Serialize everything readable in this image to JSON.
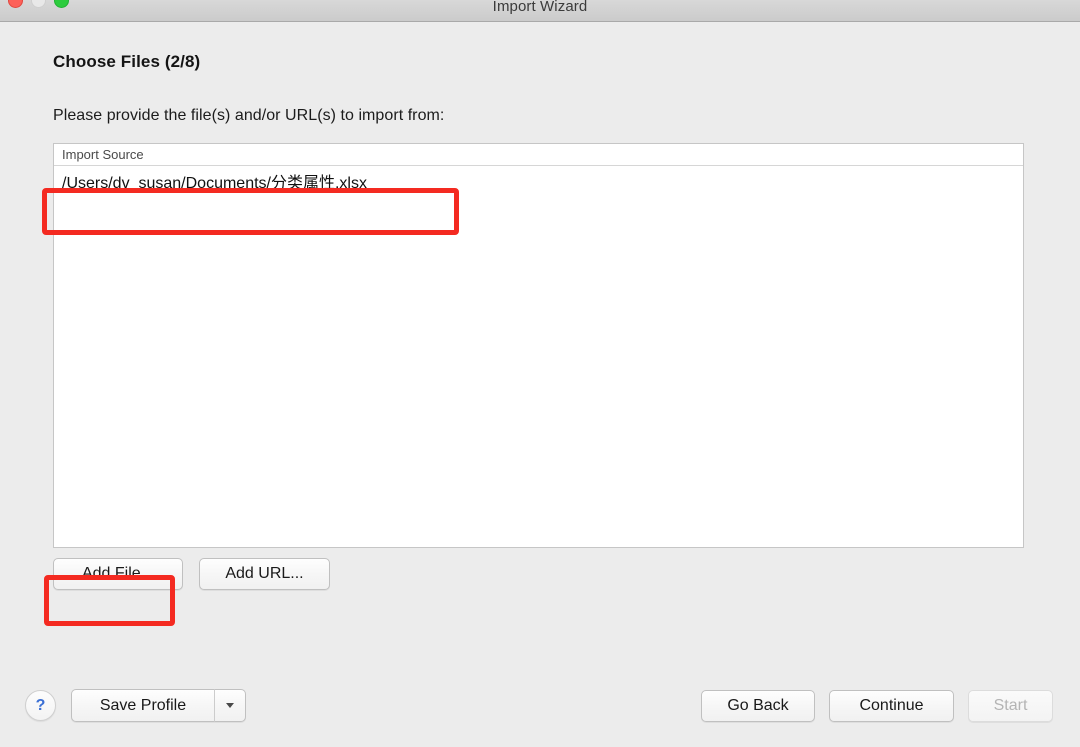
{
  "window": {
    "title": "Import Wizard",
    "traffic_lights": [
      "close",
      "minimize",
      "maximize"
    ]
  },
  "page": {
    "title": "Choose Files (2/8)",
    "instruction": "Please provide the file(s) and/or URL(s) to import from:"
  },
  "source_list": {
    "columns": [
      "Import Source"
    ],
    "rows": [
      {
        "import_source": "/Users/dv_susan/Documents/分类属性.xlsx"
      }
    ]
  },
  "actions": {
    "add_file": "Add File...",
    "add_url": "Add URL...",
    "save_profile": "Save Profile",
    "go_back": "Go Back",
    "continue": "Continue",
    "start": "Start",
    "help": "?",
    "start_disabled": true
  },
  "annotations": {
    "accent_color": "#f42a21",
    "highlighted": [
      "import-source-row",
      "add-file-button"
    ]
  },
  "colors": {
    "window_background": "#ececec",
    "titlebar": "#cfcfcf",
    "list_background": "#ffffff",
    "help_glyph": "#3b6fd4",
    "close_button": "#fd6159",
    "minimize_button": "#e8e8e8",
    "maximize_button": "#2dcc3e"
  }
}
